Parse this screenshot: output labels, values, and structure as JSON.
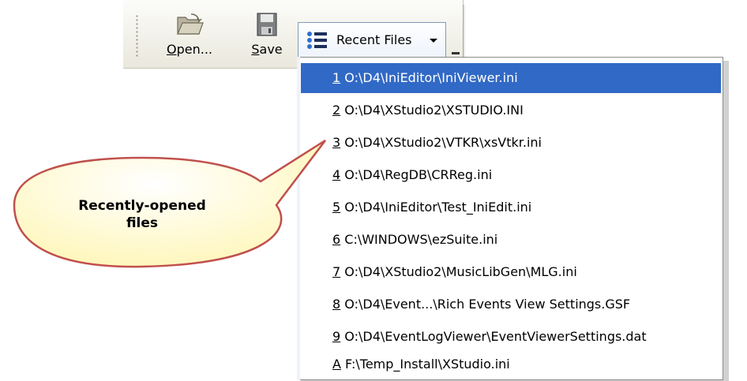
{
  "toolbar": {
    "open": {
      "label_accel": "O",
      "label_rest": "pen...",
      "icon": "folder-open-icon"
    },
    "save": {
      "label_accel": "S",
      "label_rest": "ave",
      "icon": "floppy-disk-icon"
    },
    "recent": {
      "label": "Recent Files",
      "icon": "list-icon"
    }
  },
  "menu": {
    "items": [
      {
        "accel": "1",
        "path": " O:\\D4\\IniEditor\\IniViewer.ini",
        "selected": true
      },
      {
        "accel": "2",
        "path": " O:\\D4\\XStudio2\\XSTUDIO.INI"
      },
      {
        "accel": "3",
        "path": " O:\\D4\\XStudio2\\VTKR\\xsVtkr.ini"
      },
      {
        "accel": "4",
        "path": " O:\\D4\\RegDB\\CRReg.ini"
      },
      {
        "accel": "5",
        "path": " O:\\D4\\IniEditor\\Test_IniEdit.ini"
      },
      {
        "accel": "6",
        "path": " C:\\WINDOWS\\ezSuite.ini"
      },
      {
        "accel": "7",
        "path": " O:\\D4\\XStudio2\\MusicLibGen\\MLG.ini"
      },
      {
        "accel": "8",
        "path": " O:\\D4\\Event...\\Rich Events View Settings.GSF"
      },
      {
        "accel": "9",
        "path": " O:\\D4\\EventLogViewer\\EventViewerSettings.dat"
      },
      {
        "accel": "A",
        "path": " F:\\Temp_Install\\XStudio.ini"
      }
    ]
  },
  "callout": {
    "line1": "Recently-opened",
    "line2": "files",
    "fill": "#ffffd8",
    "stroke": "#c0504d"
  },
  "colors": {
    "highlight": "#3169c6"
  }
}
